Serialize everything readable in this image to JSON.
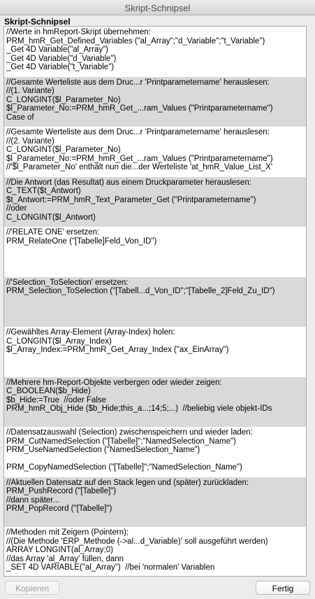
{
  "window": {
    "title": "Skript-Schnipsel"
  },
  "list_heading": "Skript-Schnipsel",
  "snippets": [
    {
      "lines": [
        "//Werte in hmReport-Skript übernehmen:",
        "PRM_hmR_Get_Defined_Variables (\"al_Array\";\"d_Variable\";\"t_Variable\")",
        "_Get 4D Variable(\"al_Array\")",
        "_Get 4D Variable(\"d_Variable\")",
        "_Get 4D Variable(\"t_Variable\")"
      ]
    },
    {
      "lines": [
        "//Gesamte Werteliste aus dem Druc...r 'Printparametername' herauslesen:",
        "//(1. Variante)",
        "C_LONGINT($l_Parameter_No)",
        "$l_Parameter_No:=PRM_hmR_Get_...ram_Values (\"Printparametername\")",
        "Case of"
      ]
    },
    {
      "lines": [
        "//Gesamte Werteliste aus dem Druc...r 'Printparametername' herauslesen:",
        "//(2. Variante)",
        "C_LONGINT($l_Parameter_No)",
        "$l_Parameter_No:=PRM_hmR_Get_...ram_Values (\"Printparametername\")",
        "//'$l_Parameter_No' enthält nun die...der Werteliste 'at_hmR_Value_List_X'"
      ]
    },
    {
      "lines": [
        "//Die Antwort (das Resultat) aus einem Druckparameter herauslesen:",
        "C_TEXT($t_Antwort)",
        "$t_Antwort:=PRM_hmR_Text_Parameter_Get (\"Printparametername\")",
        "//oder",
        "C_LONGINT($l_Antwort)"
      ]
    },
    {
      "lines": [
        "//'RELATE ONE' ersetzen:",
        "PRM_RelateOne (\"[Tabelle]Feld_Von_ID\")",
        "",
        "",
        ""
      ]
    },
    {
      "lines": [
        "//'Selection_ToSelection' ersetzen:",
        "PRM_Selection_ToSelection (\"[Tabell...d_Von_ID\";\"[Tabelle_2]Feld_Zu_ID\")",
        "",
        "",
        ""
      ]
    },
    {
      "lines": [
        "//Gewähltes Array-Element (Array-Index) holen:",
        "C_LONGINT($l_Array_Index)",
        "$l_Array_Index:=PRM_hmR_Get_Array_Index (\"ax_EinArray\")",
        "",
        ""
      ]
    },
    {
      "lines": [
        "//Mehrere hm-Report-Objekte verbergen oder wieder zeigen:",
        "C_BOOLEAN($b_Hide)",
        "$b_Hide:=True  //oder False",
        "PRM_hmR_Obj_Hide ($b_Hide;this_a...;14;5;...)  //beliebig viele objekt-IDs",
        ""
      ]
    },
    {
      "lines": [
        "//Datensatzauswahl (Selection) zwischenspeichern und wieder laden:",
        "PRM_CutNamedSelection (\"[Tabelle]\";\"NamedSelection_Name\")",
        "PRM_UseNamedSelection (\"NamedSelection_Name\")",
        "",
        "PRM_CopyNamedSelection (\"[Tabelle]\";\"NamedSelection_Name\")"
      ]
    },
    {
      "lines": [
        "//Aktuellen Datensatz auf den Stack legen und (später) zurückladen:",
        "PRM_PushRecord (\"[Tabelle]\")",
        "//dann später...",
        "PRM_PopRecord (\"[Tabelle]\")",
        ""
      ]
    },
    {
      "lines": [
        "//Methoden mit Zeigern (Pointern):",
        "//(Die Methode 'ERP_Methode (->al...d_Variable)' soll ausgeführt werden)",
        "ARRAY LONGINT(al_Array;0)",
        "//das Array 'al_Array' füllen, dann",
        "_SET 4D VARIABLE(\"al_Array\")  //bei 'normalen' Variablen"
      ]
    }
  ],
  "buttons": {
    "copy_label": "Kopieren",
    "done_label": "Fertig"
  }
}
